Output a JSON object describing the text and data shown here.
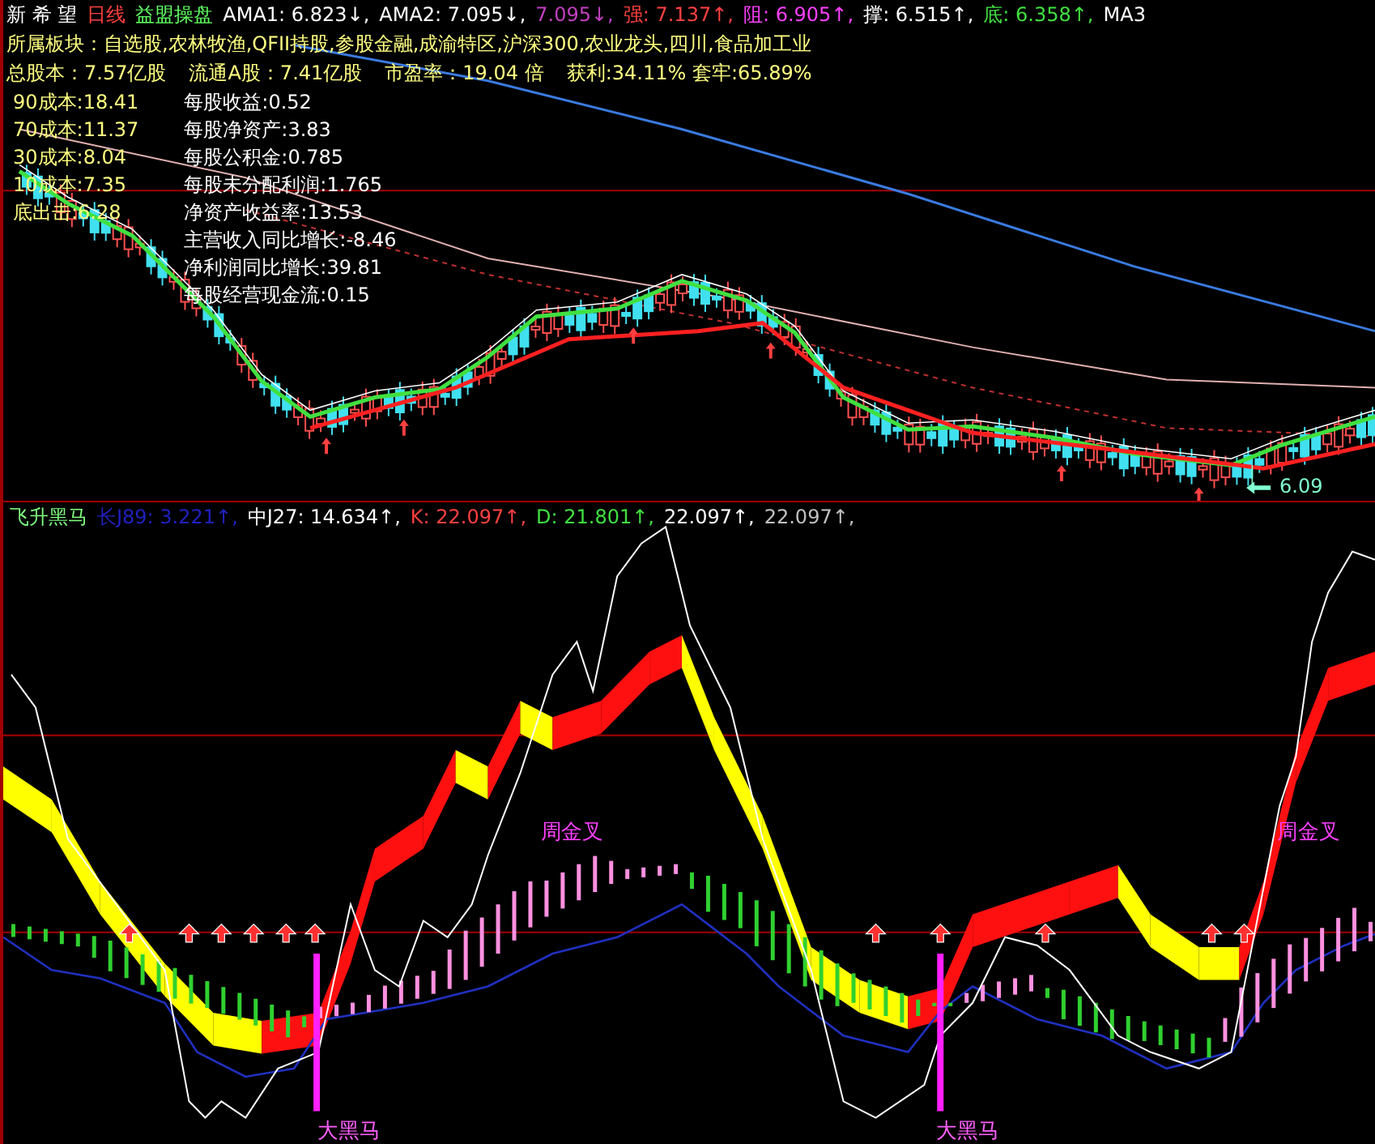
{
  "quote_bar": {
    "stock": "新 希 望",
    "period": "日线",
    "formula": "益盟操盘",
    "values": [
      {
        "text": "AMA1: 6.823↓,",
        "color": "#ffffff"
      },
      {
        "text": "AMA2: 7.095↓,",
        "color": "#ffffff"
      },
      {
        "text": "7.095↓,",
        "color": "#c040c0"
      },
      {
        "text": "强: 7.137↑,",
        "color": "#ff4040"
      },
      {
        "text": "阻: 6.905↑,",
        "color": "#ff40ff"
      },
      {
        "text": "撑: 6.515↑,",
        "color": "#ffffff"
      },
      {
        "text": "底: 6.358↑,",
        "color": "#40e040"
      },
      {
        "text": "MA3",
        "color": "#ffffff"
      }
    ]
  },
  "sector_line": "所属板块：自选股,农林牧渔,QFII持股,参股金融,成渝特区,沪深300,农业龙头,四川,食品加工业",
  "share_stats": [
    "总股本：7.57亿股",
    "流通A股：7.41亿股",
    "市盈率：19.04 倍",
    "获利:34.11% 套牢:65.89%"
  ],
  "cost_levels": [
    "90成本:18.41",
    "70成本:11.37",
    "30成本:8.04",
    "10成本:7.35",
    "底出击:6.28"
  ],
  "financials": [
    "每股收益:0.52",
    "每股净资产:3.83",
    "每股公积金:0.785",
    "每股未分配利润:1.765",
    "净资产收益率:13.53",
    "主营收入同比增长:-8.46",
    "净利润同比增长:39.81",
    "每股经营现金流:0.15"
  ],
  "low_marker": "6.09",
  "indicator": {
    "name": "飞升黑马",
    "values": [
      {
        "text": "长J89: 3.221↑,",
        "color": "#2020c0"
      },
      {
        "text": "中J27: 14.634↑,",
        "color": "#ffffff"
      },
      {
        "text": "K: 22.097↑,",
        "color": "#ff4040"
      },
      {
        "text": "D: 21.801↑,",
        "color": "#40e040"
      },
      {
        "text": "22.097↑,",
        "color": "#ffffff"
      },
      {
        "text": "22.097↑,",
        "color": "#c0c0c0"
      }
    ],
    "labels": [
      {
        "kind": "cross",
        "text": "周金叉"
      },
      {
        "kind": "cross",
        "text": "周金叉"
      },
      {
        "kind": "horse",
        "text": "大黑马"
      },
      {
        "kind": "horse",
        "text": "大黑马"
      }
    ]
  }
}
